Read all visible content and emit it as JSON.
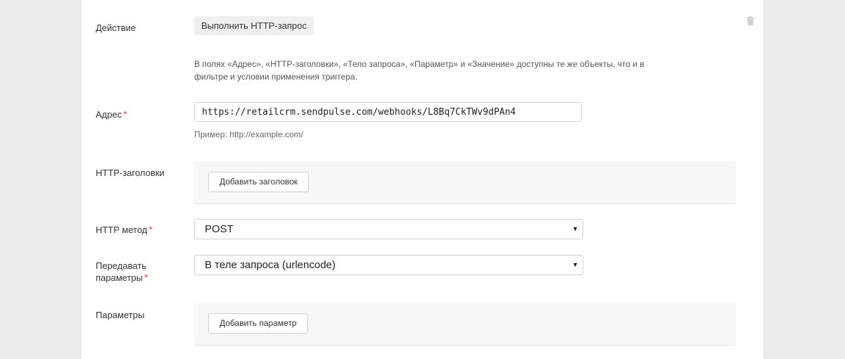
{
  "action": {
    "label": "Действие",
    "value": "Выполнить HTTP-запрос"
  },
  "hint": "В полях «Адрес», «HTTP-заголовки», «Тело запроса», «Параметр» и «Значение» доступны те же объекты, что и в фильтре и условии применения триггера.",
  "address": {
    "label": "Адрес",
    "required_mark": "*",
    "value": "https://retailcrm.sendpulse.com/webhooks/L8Bq7CkTWv9dPAn4",
    "example": "Пример: http://example.com/"
  },
  "headers": {
    "label": "HTTP-заголовки",
    "add_button": "Добавить заголовок"
  },
  "method": {
    "label": "HTTP метод",
    "required_mark": "*",
    "selected": "POST"
  },
  "params_mode": {
    "label_line1": "Передавать",
    "label_line2": "параметры",
    "required_mark": "*",
    "selected": "В теле запроса (urlencode)"
  },
  "params": {
    "label": "Параметры",
    "add_button": "Добавить параметр"
  },
  "icons": {
    "delete": "trash-icon",
    "dropdown": "caret-down-icon"
  },
  "colors": {
    "required": "#d9534f",
    "page_bg": "#ebebeb",
    "block_bg": "#f7f7f7"
  }
}
